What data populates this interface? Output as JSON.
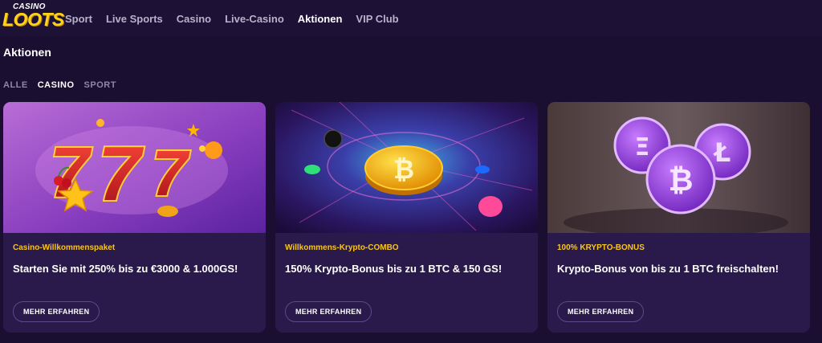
{
  "logo": {
    "small": "CASINO",
    "big": "LOOTS"
  },
  "nav": {
    "items": [
      "Sport",
      "Live Sports",
      "Casino",
      "Live-Casino",
      "Aktionen",
      "VIP Club"
    ],
    "active": "Aktionen"
  },
  "page": {
    "title": "Aktionen"
  },
  "filters": {
    "items": [
      "ALLE",
      "CASINO",
      "SPORT"
    ],
    "active": "CASINO"
  },
  "promotions": [
    {
      "tag": "Casino-Willkommenspaket",
      "headline": "Starten Sie mit 250% bis zu €3000 & 1.000GS!",
      "button": "MEHR ERFAHREN",
      "art": {
        "digits": "777"
      }
    },
    {
      "tag": "Willkommens-Krypto-COMBO",
      "headline": "150% Krypto-Bonus bis zu 1 BTC & 150 GS!",
      "button": "MEHR ERFAHREN",
      "art": {
        "coin_symbol": "₿"
      }
    },
    {
      "tag": "100% KRYPTO-BONUS",
      "headline": "Krypto-Bonus von bis zu 1 BTC freischalten!",
      "button": "MEHR ERFAHREN",
      "art": {
        "coin_symbols": [
          "Ξ",
          "Ł",
          "₿"
        ]
      }
    }
  ],
  "colors": {
    "background": "#1a0f30",
    "topbar": "#1d1236",
    "card": "#2a1a4c",
    "accent_yellow": "#f7c51e",
    "nav_inactive": "#b9b1cc",
    "filter_inactive": "#8f86a8"
  }
}
